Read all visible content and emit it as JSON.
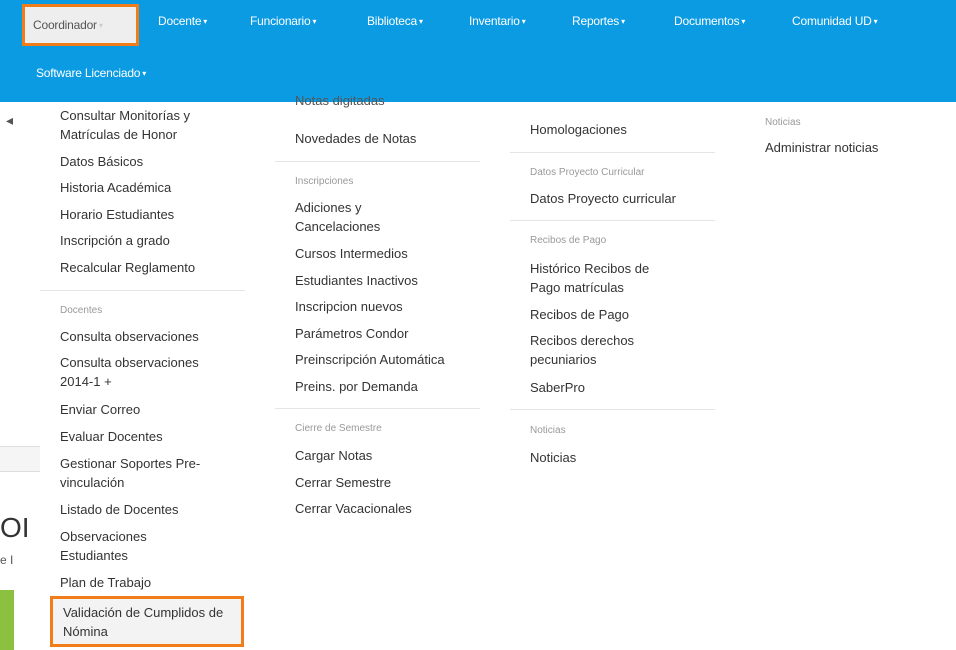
{
  "navbar": {
    "row1": [
      {
        "label": "Coordinador",
        "active": true
      },
      {
        "label": "Docente"
      },
      {
        "label": "Funcionario"
      },
      {
        "label": "Biblioteca"
      },
      {
        "label": "Inventario"
      },
      {
        "label": "Reportes"
      },
      {
        "label": "Documentos"
      },
      {
        "label": "Comunidad UD"
      }
    ],
    "row2": [
      {
        "label": "Software Licenciado"
      }
    ],
    "caret": "▾"
  },
  "dropdown": {
    "col1": {
      "items_top": [
        "Consultar Monitorías y Matrículas de Honor",
        "Datos Básicos",
        "Historia Académica",
        "Horario Estudiantes",
        "Inscripción a grado",
        "Recalcular Reglamento"
      ],
      "docentes_header": "Docentes",
      "docentes_items": [
        "Consulta observaciones",
        "Consulta observaciones 2014-1 +",
        "Enviar Correo",
        "Evaluar Docentes",
        "Gestionar Soportes Pre-vinculación",
        "Listado de Docentes",
        "Observaciones Estudiantes",
        "Plan de Trabajo",
        "Validación de Cumplidos de Nómina"
      ]
    },
    "col2": {
      "items_top": [
        "Notas digitadas",
        "Novedades de Notas"
      ],
      "inscripciones_header": "Inscripciones",
      "inscripciones_items": [
        "Adiciones y Cancelaciones",
        "Cursos Intermedios",
        "Estudiantes Inactivos",
        "Inscripcion nuevos",
        "Parámetros Condor",
        "Preinscripción Automática",
        "Preins. por Demanda"
      ],
      "cierre_header": "Cierre de Semestre",
      "cierre_items": [
        "Cargar Notas",
        "Cerrar Semestre",
        "Cerrar Vacacionales"
      ]
    },
    "col3": {
      "items_top": [
        "Homologaciones"
      ],
      "proyecto_header": "Datos Proyecto Curricular",
      "proyecto_items": [
        "Datos Proyecto curricular"
      ],
      "recibos_header": "Recibos de Pago",
      "recibos_items": [
        "Histórico Recibos de Pago matrículas",
        "Recibos de Pago",
        "Recibos derechos pecuniarios",
        "SaberPro"
      ],
      "noticias_header": "Noticias",
      "noticias_items": [
        "Noticias"
      ]
    },
    "col4": {
      "noticias_header": "Noticias",
      "noticias_items": [
        "Administrar noticias"
      ]
    }
  },
  "page_fragments": {
    "big_text": "OI",
    "small_text": "e I"
  },
  "colors": {
    "navbar": "#0b9be3",
    "highlight": "#f07c1a",
    "green_block": "#8cc13f"
  }
}
